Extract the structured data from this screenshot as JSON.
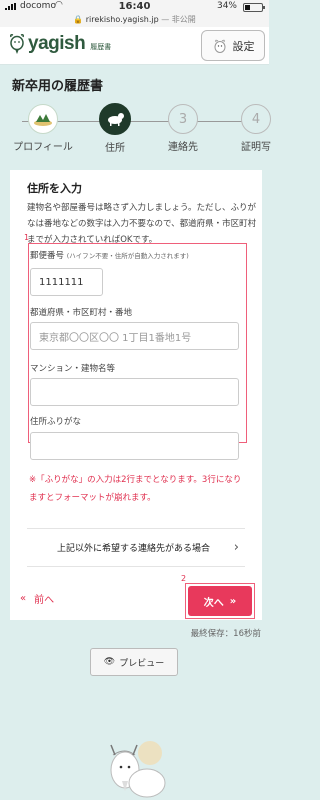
{
  "status_bar": {
    "carrier": "docomo",
    "time": "16:40",
    "battery": "34%",
    "battery_level": 0.34,
    "url": "rirekisho.yagish.jp",
    "privacy": "— 非公開"
  },
  "header": {
    "logo_text": "yagish",
    "logo_sub": "履歴書",
    "settings_label": "設定"
  },
  "page_title": "新卒用の履歴書",
  "stepper": {
    "steps": [
      {
        "label": "プロフィール",
        "number": "",
        "state": "done"
      },
      {
        "label": "住所",
        "number": "",
        "state": "current"
      },
      {
        "label": "連絡先",
        "number": "3",
        "state": "future"
      },
      {
        "label": "証明写",
        "number": "4",
        "state": "future"
      }
    ]
  },
  "form": {
    "title": "住所を入力",
    "description": "建物名や部屋番号は略さず入力しましょう。ただし、ふりがなは番地などの数字は入力不要なので、都道府県・市区町村までが入力されていればOKです。",
    "annotation_1": "1",
    "postal": {
      "label": "郵便番号",
      "note": "(ハイフン不要・住所が自動入力されます)",
      "value": "1111111"
    },
    "address": {
      "label": "都道府県・市区町村・番地",
      "value": "東京都〇〇区〇〇 1丁目1番地1号"
    },
    "building": {
      "label": "マンション・建物名等",
      "value": ""
    },
    "furigana": {
      "label": "住所ふりがな",
      "value": ""
    },
    "warning": "※「ふりがな」の入力は2行までとなります。3行になりますとフォーマットが崩れます。",
    "other_contact": "上記以外に希望する連絡先がある場合"
  },
  "nav": {
    "back_label": "前へ",
    "back_icon": "«",
    "next_label": "次へ",
    "next_icon": "»",
    "annotation_2": "2"
  },
  "last_saved": "最終保存：16秒前",
  "preview_label": "プレビュー",
  "colors": {
    "accent": "#e8395c",
    "background": "#ddeeed",
    "brand_green": "#2f5a3e"
  }
}
